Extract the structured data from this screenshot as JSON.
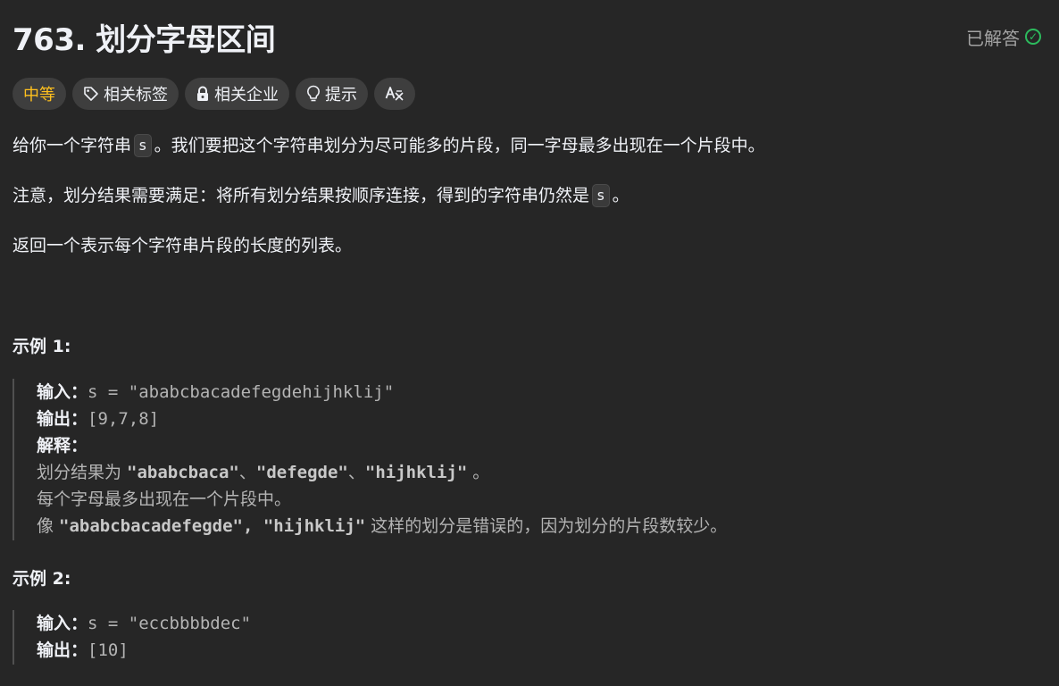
{
  "problem": {
    "title": "763. 划分字母区间",
    "status_label": "已解答"
  },
  "tags": {
    "difficulty": "中等",
    "topics": "相关标签",
    "companies": "相关企业",
    "hint": "提示",
    "translate_icon": "translate-icon"
  },
  "description": {
    "p1_a": "给你一个字符串",
    "p1_code": "s",
    "p1_b": "。我们要把这个字符串划分为尽可能多的片段，同一字母最多出现在一个片段中。",
    "p2_a": "注意，划分结果需要满足：将所有划分结果按顺序连接，得到的字符串仍然是",
    "p2_code": "s",
    "p2_b": "。",
    "p3": "返回一个表示每个字符串片段的长度的列表。"
  },
  "examples": [
    {
      "title": "示例 1:",
      "input_label": "输入：",
      "input_value": "s = \"ababcbacadefegdehijhklij\"",
      "output_label": "输出：",
      "output_value": "[9,7,8]",
      "explain_label": "解释：",
      "explain_l1_a": "划分结果为 ",
      "explain_l1_p1": "\"ababcbaca\"",
      "explain_l1_sep1": "、",
      "explain_l1_p2": "\"defegde\"",
      "explain_l1_sep2": "、",
      "explain_l1_p3": "\"hijhklij\"",
      "explain_l1_end": " 。",
      "explain_l2": "每个字母最多出现在一个片段中。",
      "explain_l3_a": "像 ",
      "explain_l3_p": "\"ababcbacadefegde\", \"hijhklij\"",
      "explain_l3_b": " 这样的划分是错误的，因为划分的片段数较少。"
    },
    {
      "title": "示例 2:",
      "input_label": "输入：",
      "input_value": "s = \"eccbbbbdec\"",
      "output_label": "输出：",
      "output_value": "[10]"
    }
  ],
  "colors": {
    "background": "#262626",
    "difficulty_medium": "#ffc01e",
    "solved_green": "#2cbb5d",
    "tag_bg": "#3e3e3e"
  }
}
